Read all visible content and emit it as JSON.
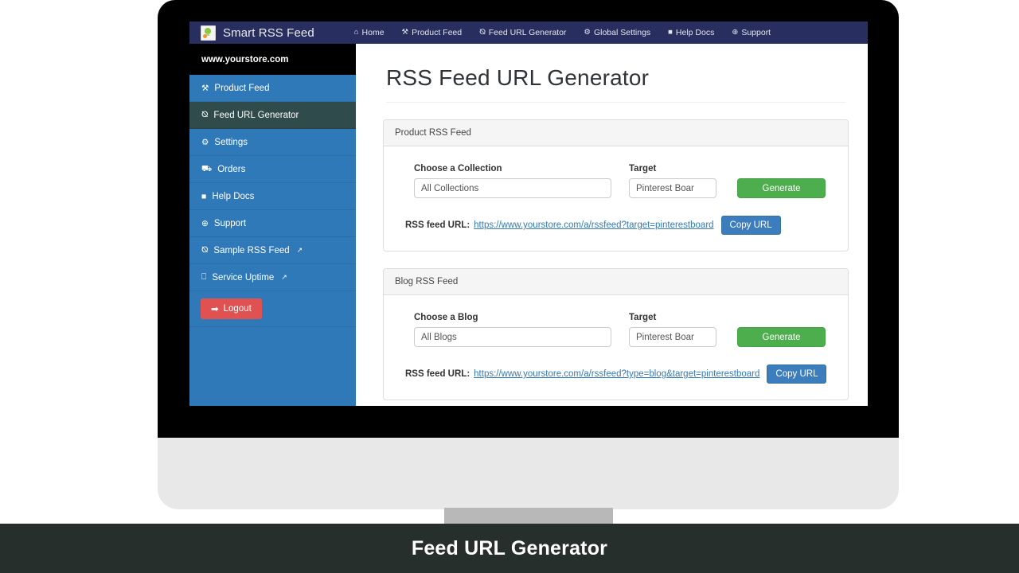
{
  "navbar": {
    "brand": "Smart RSS Feed",
    "logo_icon": "lightbulb-logo-icon",
    "links": [
      {
        "label": "Home",
        "icon": "home-icon",
        "glyph": "⌂"
      },
      {
        "label": "Product Feed",
        "icon": "wrench-icon",
        "glyph": "⚒"
      },
      {
        "label": "Feed URL Generator",
        "icon": "rss-icon",
        "glyph": "⦰"
      },
      {
        "label": "Global Settings",
        "icon": "gears-icon",
        "glyph": "⚙"
      },
      {
        "label": "Help Docs",
        "icon": "book-icon",
        "glyph": "■"
      },
      {
        "label": "Support",
        "icon": "lifering-icon",
        "glyph": "⊕"
      }
    ]
  },
  "sidebar": {
    "store_name": "www.yourstore.com",
    "items": [
      {
        "label": "Product Feed",
        "icon": "wrench-icon",
        "glyph": "⚒",
        "active": false,
        "external": false
      },
      {
        "label": "Feed URL Generator",
        "icon": "rss-icon",
        "glyph": "⦰",
        "active": true,
        "external": false
      },
      {
        "label": "Settings",
        "icon": "gears-icon",
        "glyph": "⚙",
        "active": false,
        "external": false
      },
      {
        "label": "Orders",
        "icon": "cart-icon",
        "glyph": "⛟",
        "active": false,
        "external": false
      },
      {
        "label": "Help Docs",
        "icon": "book-icon",
        "glyph": "■",
        "active": false,
        "external": false
      },
      {
        "label": "Support",
        "icon": "lifering-icon",
        "glyph": "⊕",
        "active": false,
        "external": false
      },
      {
        "label": "Sample RSS Feed",
        "icon": "rss-icon",
        "glyph": "⦰",
        "active": false,
        "external": true
      },
      {
        "label": "Service Uptime",
        "icon": "monitor-icon",
        "glyph": "⎕",
        "active": false,
        "external": false,
        "external_after": true
      }
    ],
    "external_glyph": "↗",
    "logout": {
      "label": "Logout",
      "icon": "sign-out-icon",
      "glyph": "➡"
    }
  },
  "main": {
    "page_title": "RSS Feed URL Generator",
    "panels": [
      {
        "heading": "Product RSS Feed",
        "select_label": "Choose a Collection",
        "select_value": "All Collections",
        "target_label": "Target",
        "target_value": "Pinterest Boar",
        "generate_label": "Generate",
        "url_label": "RSS feed URL:",
        "url_value": "https://www.yourstore.com/a/rssfeed?target=pinterestboard",
        "copy_label": "Copy URL"
      },
      {
        "heading": "Blog RSS Feed",
        "select_label": "Choose a Blog",
        "select_value": "All Blogs",
        "target_label": "Target",
        "target_value": "Pinterest Boar",
        "generate_label": "Generate",
        "url_label": "RSS feed URL:",
        "url_value": "https://www.yourstore.com/a/rssfeed?type=blog&target=pinterestboard",
        "copy_label": "Copy URL"
      }
    ]
  },
  "caption": {
    "text": "Feed URL Generator"
  },
  "colors": {
    "navbar": "#282f5e",
    "sidebar": "#3079b8",
    "sidebar_active": "#2f4b4b",
    "generate_green": "#4cae4c",
    "copy_blue": "#3b7dbd",
    "logout_red": "#e05252",
    "link_blue": "#337ab7",
    "caption_bar": "#262f2b"
  }
}
